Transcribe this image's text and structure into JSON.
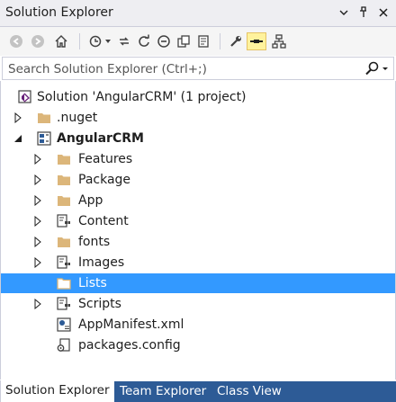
{
  "window": {
    "title": "Solution Explorer"
  },
  "toolbar": {
    "icons": [
      "back-icon",
      "forward-icon",
      "home-icon",
      "sync-with-document-icon",
      "pending-changes-filter-icon",
      "dropdown-icon",
      "refresh-icon",
      "collapse-all-icon",
      "show-all-files-icon",
      "properties-icon",
      "preview-selected-items-icon",
      "pin-icon",
      "class-view-icon"
    ]
  },
  "search": {
    "placeholder": "Search Solution Explorer (Ctrl+;)"
  },
  "tree": {
    "solution": "Solution 'AngularCRM' (1 project)",
    "nuget": ".nuget",
    "project": "AngularCRM",
    "features": "Features",
    "package": "Package",
    "app": "App",
    "content": "Content",
    "fonts": "fonts",
    "images": "Images",
    "lists": "Lists",
    "scripts": "Scripts",
    "manifest": "AppManifest.xml",
    "packages": "packages.config"
  },
  "tabs": {
    "solution_explorer": "Solution Explorer",
    "team_explorer": "Team Explorer",
    "class_view": "Class View"
  },
  "colors": {
    "selection": "#3399ff",
    "tab_bar": "#2d5b96",
    "folder": "#dcb67a",
    "accent": "#68217a"
  }
}
